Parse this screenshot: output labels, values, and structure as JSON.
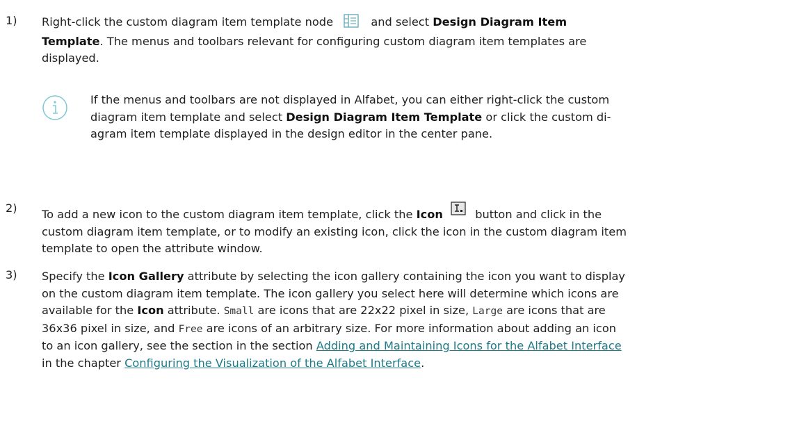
{
  "step1": {
    "number": "1)",
    "l1_pre": "Right-click the custom diagram item template node",
    "l1_mid": "and select",
    "l1_bold": "Design Diagram Item",
    "l2_bold": "Template",
    "l2_rest": ". The menus and toolbars relevant for configuring custom diagram item templates are",
    "l3": "displayed.",
    "icon": "diagram-template-node-icon"
  },
  "note": {
    "icon": "info-icon",
    "l1": "If the menus and toolbars are not displayed in Alfabet, you can either right-click the custom",
    "l2_pre": "diagram item template and select",
    "l2_bold": "Design Diagram Item Template",
    "l2_post": "or click the custom di-",
    "l3": "agram item template displayed in the design editor in the center pane."
  },
  "step2": {
    "number": "2)",
    "l1_pre": "To add a new icon to the custom diagram item template, click the",
    "l1_bold": "Icon",
    "l1_post": "button and click in the",
    "l2": "custom diagram item template, or to modify an existing icon, click the icon in the custom diagram item",
    "l3": "template to open the attribute window.",
    "icon": "icon-tool-button-icon"
  },
  "step3": {
    "number": "3)",
    "l1_pre": "Specify the",
    "l1_bold": "Icon Gallery",
    "l1_post": "attribute by selecting the icon gallery containing the icon you want to display",
    "l2": "on the custom diagram item template. The icon gallery you select here will determine which icons are",
    "l3_pre": "available for the",
    "l3_bold": "Icon",
    "l3_mid": "attribute.",
    "l3_code1": "Small",
    "l3_mid2": "are icons that are 22x22 pixel in size,",
    "l3_code2": "Large",
    "l3_post": "are icons that are",
    "l4_pre": "36x36 pixel in size, and",
    "l4_code": "Free",
    "l4_post": "are icons of an arbitrary size. For more information about adding an icon",
    "l5_pre": "to an icon gallery, see the section in the section",
    "l5_link": "Adding and Maintaining Icons for the Alfabet Interface",
    "l6_pre": "in the chapter",
    "l6_link": "Configuring the Visualization of the Alfabet Interface",
    "l6_post": "."
  },
  "colors": {
    "link": "#1f7a86",
    "text": "#222222",
    "info_icon": "#7cc8d4"
  }
}
